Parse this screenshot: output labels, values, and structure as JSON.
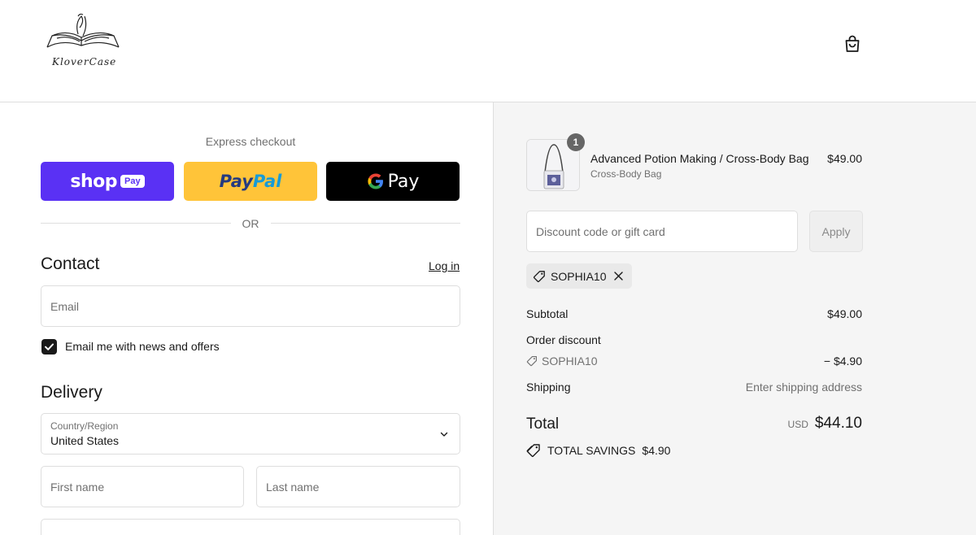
{
  "header": {
    "logo_text": "KloverCase",
    "cart_icon": "shopping-bag-icon"
  },
  "express": {
    "title": "Express checkout",
    "shop_pay": {
      "word": "shop",
      "pay": "Pay"
    },
    "paypal": {
      "part1": "Pay",
      "part2": "Pal"
    },
    "gpay": {
      "g": "G",
      "word": "Pay"
    },
    "or": "OR"
  },
  "contact": {
    "title": "Contact",
    "login": "Log in",
    "email_placeholder": "Email",
    "newsletter_label": "Email me with news and offers",
    "newsletter_checked": true
  },
  "delivery": {
    "title": "Delivery",
    "country_label": "Country/Region",
    "country_value": "United States",
    "first_name_placeholder": "First name",
    "last_name_placeholder": "Last name"
  },
  "summary": {
    "product": {
      "quantity": "1",
      "name": "Advanced Potion Making / Cross-Body Bag",
      "variant": "Cross-Body Bag",
      "price": "$49.00"
    },
    "discount_placeholder": "Discount code or gift card",
    "apply_label": "Apply",
    "applied_code": "SOPHIA10",
    "subtotal_label": "Subtotal",
    "subtotal_value": "$49.00",
    "order_discount_label": "Order discount",
    "discount_code": "SOPHIA10",
    "discount_value": "− $4.90",
    "shipping_label": "Shipping",
    "shipping_value": "Enter shipping address",
    "total_label": "Total",
    "currency": "USD",
    "total_value": "$44.10",
    "savings_label": "TOTAL SAVINGS",
    "savings_value": "$4.90"
  },
  "colors": {
    "shop_pay": "#5a31f4",
    "paypal": "#ffc439",
    "gpay": "#000000",
    "summary_bg": "#f5f5f5"
  }
}
